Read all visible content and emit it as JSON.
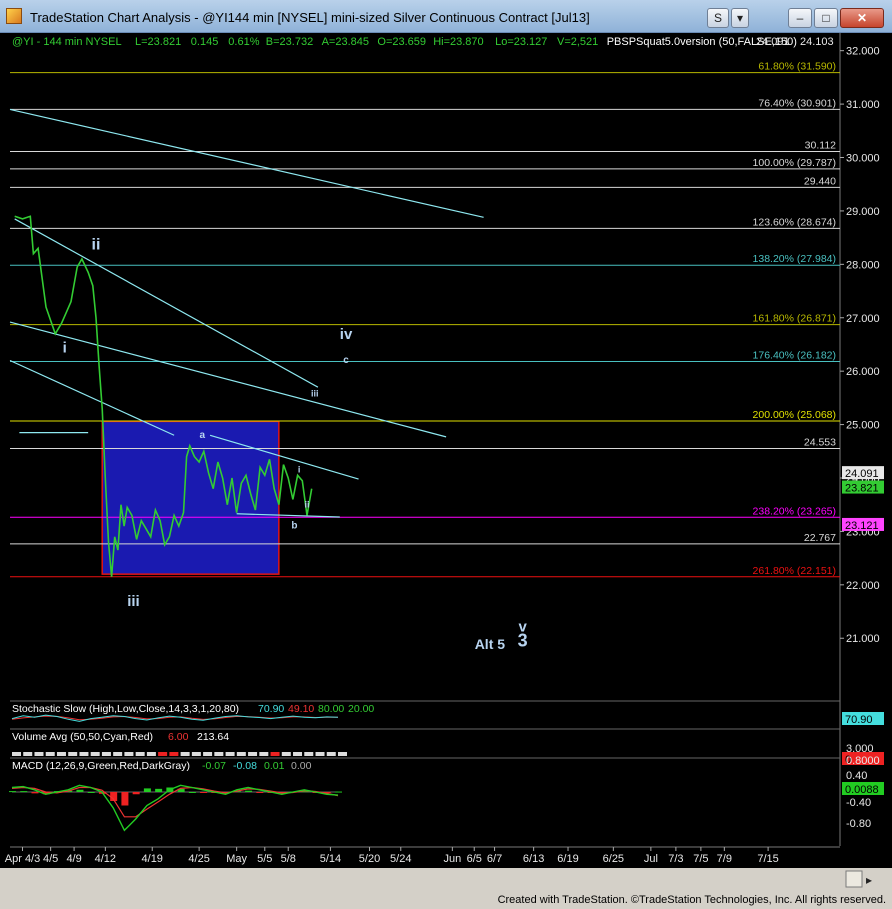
{
  "window": {
    "title": "TradeStation Chart Analysis - @YI144 min [NYSEL] mini-sized Silver Continuous Contract [Jul13]",
    "buttons": [
      "S",
      "▾",
      "–",
      "□",
      "✕"
    ]
  },
  "status": {
    "credit": "Created with TradeStation. ©TradeStation Technologies, Inc. All rights reserved."
  },
  "colors": {
    "background": "#000000",
    "price": "#33cc33",
    "fib_line": "#b8d8f0",
    "magenta": "#ff00ff",
    "red": "#ee1111",
    "yellow": "#e0e000",
    "trend": "#8ee8f0",
    "box_fill": "#1a1ab0",
    "box_border": "#e01515"
  },
  "chart_data": {
    "type": "line",
    "header": {
      "symbol": "@YI - 144 min  NYSEL",
      "fields": [
        {
          "label": "L",
          "value": "23.821"
        },
        {
          "label": "",
          "value": "0.145"
        },
        {
          "label": "",
          "value": "0.61%"
        },
        {
          "label": "B",
          "value": "23.732"
        },
        {
          "label": "A",
          "value": "23.845"
        },
        {
          "label": "O",
          "value": "23.659"
        },
        {
          "label": "Hi",
          "value": "23.870"
        },
        {
          "label": "Lo",
          "value": "23.127"
        },
        {
          "label": "V",
          "value": "2,521"
        }
      ],
      "indicator": "PBSPSquat5.0version (50,FALSE,150)",
      "right_values": [
        "24.091",
        "24.103"
      ]
    },
    "x_tick_labels": [
      "Apr 4/3",
      "4/5",
      "4/9",
      "4/12",
      "4/19",
      "4/25",
      "May",
      "5/5",
      "5/8",
      "5/14",
      "5/20",
      "5/24",
      "Jun",
      "6/5",
      "6/7",
      "6/13",
      "6/19",
      "6/25",
      "Jul",
      "7/3",
      "7/5",
      "7/9",
      "7/15"
    ],
    "x_tick_positions": [
      0.5,
      2.3,
      3.8,
      5.8,
      8.8,
      11.8,
      14.2,
      16.0,
      17.5,
      20.2,
      22.7,
      24.7,
      28.0,
      29.4,
      30.7,
      33.2,
      35.4,
      38.3,
      40.7,
      42.3,
      43.9,
      45.4,
      48.2
    ],
    "xlim": [
      -0.3,
      52.8
    ],
    "ylim": [
      19.825,
      32.2
    ],
    "y_ticks": [
      32.0,
      31.0,
      30.0,
      29.0,
      28.0,
      27.0,
      26.0,
      25.0,
      24.0,
      23.0,
      22.0,
      21.0
    ],
    "series": [
      {
        "x": [
          0,
          0.5,
          1,
          1.2,
          1.5,
          2,
          2.3,
          2.6,
          3,
          3.3,
          3.6,
          4,
          4.3,
          4.7,
          5,
          5.2,
          5.4,
          5.6,
          5.8,
          6,
          6.2,
          6.4,
          6.6,
          6.8,
          7,
          7.2,
          7.5,
          7.8,
          8.1,
          8.4,
          8.7,
          9,
          9.3,
          9.6,
          9.9,
          10.2,
          10.5,
          10.8,
          11,
          11.2,
          11.5,
          11.8,
          12.1,
          12.4,
          12.7,
          13,
          13.3,
          13.6,
          13.9,
          14.2,
          14.5,
          14.8,
          15.1,
          15.4,
          15.7,
          16,
          16.3,
          16.6,
          16.9,
          17.2,
          17.5,
          17.8,
          18.1,
          18.4,
          18.7,
          19
        ],
        "y": [
          28.9,
          28.85,
          28.9,
          28.2,
          28.3,
          27.2,
          26.95,
          26.7,
          26.9,
          27.1,
          27.3,
          27.95,
          28.1,
          27.85,
          27.6,
          27.0,
          26.1,
          25.3,
          24.0,
          22.8,
          22.15,
          22.9,
          22.65,
          23.5,
          23.1,
          23.45,
          23.3,
          22.85,
          23.2,
          23.05,
          22.9,
          23.4,
          23.2,
          22.75,
          22.9,
          23.3,
          23.1,
          23.35,
          24.4,
          24.6,
          24.4,
          24.3,
          24.5,
          24.1,
          23.8,
          24.3,
          24.0,
          23.5,
          24.0,
          23.35,
          23.9,
          24.05,
          23.7,
          23.4,
          24.2,
          24.05,
          24.35,
          23.8,
          23.5,
          24.25,
          24.0,
          23.6,
          24.05,
          23.95,
          23.3,
          23.8
        ]
      }
    ],
    "box": {
      "x0": 5.6,
      "x1": 16.9,
      "y0": 22.2,
      "y1": 25.06
    },
    "horizontal_levels": [
      {
        "y": 31.59,
        "label": "61.80% (31.590)",
        "color": "#b8b800"
      },
      {
        "y": 30.901,
        "label": "76.40% (30.901)",
        "color": "#d8d8d8"
      },
      {
        "y": 30.112,
        "label": "30.112",
        "color": "#d8d8d8"
      },
      {
        "y": 29.787,
        "label": "100.00% (29.787)",
        "color": "#d8d8d8"
      },
      {
        "y": 29.44,
        "label": "29.440",
        "color": "#d8d8d8"
      },
      {
        "y": 28.674,
        "label": "123.60% (28.674)",
        "color": "#d8d8d8"
      },
      {
        "y": 27.984,
        "label": "138.20% (27.984)",
        "color": "#49c0c0"
      },
      {
        "y": 26.871,
        "label": "161.80% (26.871)",
        "color": "#b8b800"
      },
      {
        "y": 26.182,
        "label": "176.40% (26.182)",
        "color": "#49c0c0"
      },
      {
        "y": 25.068,
        "label": "200.00% (25.068)",
        "color": "#e0e000"
      },
      {
        "y": 24.553,
        "label": "24.553",
        "color": "#d8d8d8"
      },
      {
        "y": 23.265,
        "label": "238.20% (23.265)",
        "color": "#ff00ff"
      },
      {
        "y": 22.767,
        "label": "22.767",
        "color": "#d8d8d8"
      },
      {
        "y": 22.151,
        "label": "261.80% (22.151)",
        "color": "#ee1111"
      }
    ],
    "trendlines": [
      {
        "x0": -0.3,
        "y0": 30.9,
        "x1": 30.0,
        "y1": 28.88
      },
      {
        "x0": 0.0,
        "y0": 28.85,
        "x1": 19.4,
        "y1": 25.7
      },
      {
        "x0": -0.3,
        "y0": 26.92,
        "x1": 27.6,
        "y1": 24.77
      },
      {
        "x0": -0.3,
        "y0": 26.2,
        "x1": 10.2,
        "y1": 24.8
      },
      {
        "x0": 12.5,
        "y0": 24.8,
        "x1": 22.0,
        "y1": 23.98
      },
      {
        "x0": 14.2,
        "y0": 23.33,
        "x1": 20.8,
        "y1": 23.27
      },
      {
        "x0": 0.3,
        "y0": 24.85,
        "x1": 4.7,
        "y1": 24.85
      }
    ],
    "wave_labels": [
      {
        "text": "ii",
        "x": 5.2,
        "y": 28.28,
        "size": 16
      },
      {
        "text": "i",
        "x": 3.2,
        "y": 26.35,
        "size": 15
      },
      {
        "text": "iii",
        "x": 7.6,
        "y": 21.6,
        "size": 15
      },
      {
        "text": "iv",
        "x": 21.2,
        "y": 26.6,
        "size": 15
      },
      {
        "text": "c",
        "x": 21.2,
        "y": 26.15,
        "size": 10
      },
      {
        "text": "iii",
        "x": 19.2,
        "y": 25.53,
        "size": 9
      },
      {
        "text": "a",
        "x": 12.0,
        "y": 24.75,
        "size": 10
      },
      {
        "text": "i",
        "x": 18.2,
        "y": 24.1,
        "size": 9
      },
      {
        "text": "ii",
        "x": 18.7,
        "y": 23.45,
        "size": 9
      },
      {
        "text": "b",
        "x": 17.9,
        "y": 23.05,
        "size": 10
      },
      {
        "text": "v",
        "x": 32.5,
        "y": 21.13,
        "size": 15
      },
      {
        "text": "3",
        "x": 32.5,
        "y": 20.85,
        "size": 18
      },
      {
        "text": "Alt 5",
        "x": 30.4,
        "y": 20.8,
        "size": 14
      }
    ],
    "right_markers": [
      {
        "value": "24.091",
        "y": 24.091,
        "bg": "#e8e8e8",
        "fg": "#000000"
      },
      {
        "value": "23.821",
        "y": 23.821,
        "bg": "#33cc33",
        "fg": "#000000"
      },
      {
        "value": "23.121",
        "y": 23.121,
        "bg": "#ff44ff",
        "fg": "#000000"
      }
    ],
    "stochastic": {
      "title": "Stochastic Slow (High,Low,Close,14,3,3,1,20,80)",
      "values": [
        "70.90",
        "49.10",
        "80.00",
        "20.00"
      ],
      "marker": "70.90",
      "k": [
        60,
        80,
        70,
        85,
        75,
        55,
        40,
        60,
        70,
        80,
        75,
        60,
        50,
        65,
        78,
        70,
        55,
        48,
        62,
        75,
        80,
        72,
        68,
        60,
        70,
        78,
        70,
        66,
        72,
        70
      ],
      "d": [
        55,
        65,
        72,
        78,
        76,
        65,
        52,
        55,
        62,
        72,
        75,
        68,
        58,
        60,
        70,
        72,
        62,
        54,
        58,
        68,
        76,
        74,
        70,
        64,
        66,
        72,
        72,
        68,
        70,
        70
      ]
    },
    "volume": {
      "title": "Volume Avg (50,50,Cyan,Red)",
      "values": [
        "6.00",
        "213.64"
      ],
      "y_ticks": [
        "3.000",
        "0"
      ],
      "red": [
        0,
        0,
        0,
        0,
        0,
        0,
        0,
        0,
        0,
        0,
        0,
        0,
        0,
        1,
        1,
        0,
        0,
        0,
        0,
        0,
        0,
        0,
        0,
        1,
        0,
        0,
        0,
        0,
        0,
        0
      ]
    },
    "macd": {
      "title": "MACD (12,26,9,Green,Red,DarkGray)",
      "values": [
        "-0.07",
        "-0.08",
        "0.01",
        "0.00"
      ],
      "y_ticks": [
        "0.8000",
        "0.40",
        "0.00",
        "-0.40",
        "-0.80"
      ],
      "marker": "0.0088",
      "macd": [
        0.1,
        0.12,
        0.05,
        -0.05,
        0.0,
        0.05,
        0.15,
        0.1,
        0.0,
        -0.35,
        -0.85,
        -0.6,
        -0.3,
        -0.15,
        0.05,
        0.15,
        0.1,
        0.05,
        0.0,
        -0.05,
        0.05,
        0.1,
        0.05,
        0.0,
        -0.05,
        0.0,
        0.05,
        0.0,
        -0.05,
        -0.07
      ],
      "signal": [
        0.08,
        0.1,
        0.08,
        0.0,
        -0.02,
        0.02,
        0.1,
        0.1,
        0.04,
        -0.15,
        -0.55,
        -0.55,
        -0.38,
        -0.22,
        -0.05,
        0.08,
        0.1,
        0.07,
        0.02,
        -0.02,
        0.02,
        0.07,
        0.06,
        0.02,
        -0.02,
        -0.01,
        0.03,
        0.01,
        -0.03,
        -0.08
      ],
      "hist": [
        0.02,
        0.02,
        -0.03,
        -0.05,
        0.02,
        0.03,
        0.05,
        0.0,
        -0.04,
        -0.2,
        -0.3,
        -0.05,
        0.08,
        0.07,
        0.1,
        0.07,
        0.0,
        -0.02,
        -0.02,
        -0.03,
        0.03,
        0.03,
        -0.01,
        -0.02,
        -0.03,
        0.01,
        0.02,
        -0.01,
        -0.02,
        0.01
      ]
    }
  }
}
